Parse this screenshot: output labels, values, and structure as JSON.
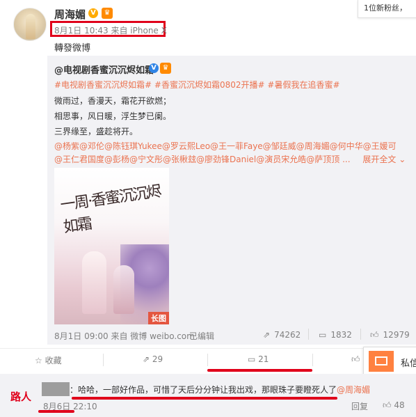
{
  "notification": {
    "text": "1位新粉丝，"
  },
  "post": {
    "username": "周海媚",
    "vip_badge": "V",
    "meta": "8月1日 10:43 来自 iPhone X",
    "text": "轉發微博"
  },
  "original": {
    "author": "@电视剧香蜜沉沉烬如霜",
    "v_badge": "V",
    "hashtags": "#电视剧香蜜沉沉烬如霜# #香蜜沉沉烬如霜0802开播# #暑假我在追香蜜#",
    "lines": [
      "微雨过，香漫天，霜花开欲燃；",
      "相思事，风日暖，浮生梦已阑。",
      "三界缘至，盛趁将开。"
    ],
    "mentions_1": "@杨紫@邓伦@陈钰琪Yukee@罗云熙Leo@王一菲Faye@邹廷威@周海媚@何中华@王媛可",
    "mentions_2": "@王仁君国度@彭杨@宁文彤@张楸玆@廖劲锋Daniel@演员宋允皓@萨顶顶 ...",
    "expand": "展开全文",
    "poster_badge": "长图",
    "poster_calligraphy": "一周·香蜜沉沉烬如霜",
    "footer": "8月1日 09:00 来自 微博 weibo.com",
    "edited": "已编辑",
    "reposts": "74262",
    "comments": "1832",
    "likes": "12979"
  },
  "actions": {
    "favorite": "收藏",
    "repost_count": "29",
    "comment_count": "21",
    "like_count": ""
  },
  "pm": {
    "label": "私信"
  },
  "comment": {
    "tag": "路人",
    "text_prefix": "：哈哈，一部好作品，可惜了天后分分钟让我出戏，那眼珠子要瞪死人了",
    "mention": "@周海媚",
    "time": "8月6日 22:10",
    "reply": "回复",
    "likes": "48"
  },
  "colors": {
    "accent_red": "#e0001b",
    "link_orange": "#eb7350",
    "card_bg": "#f2f2f5"
  }
}
